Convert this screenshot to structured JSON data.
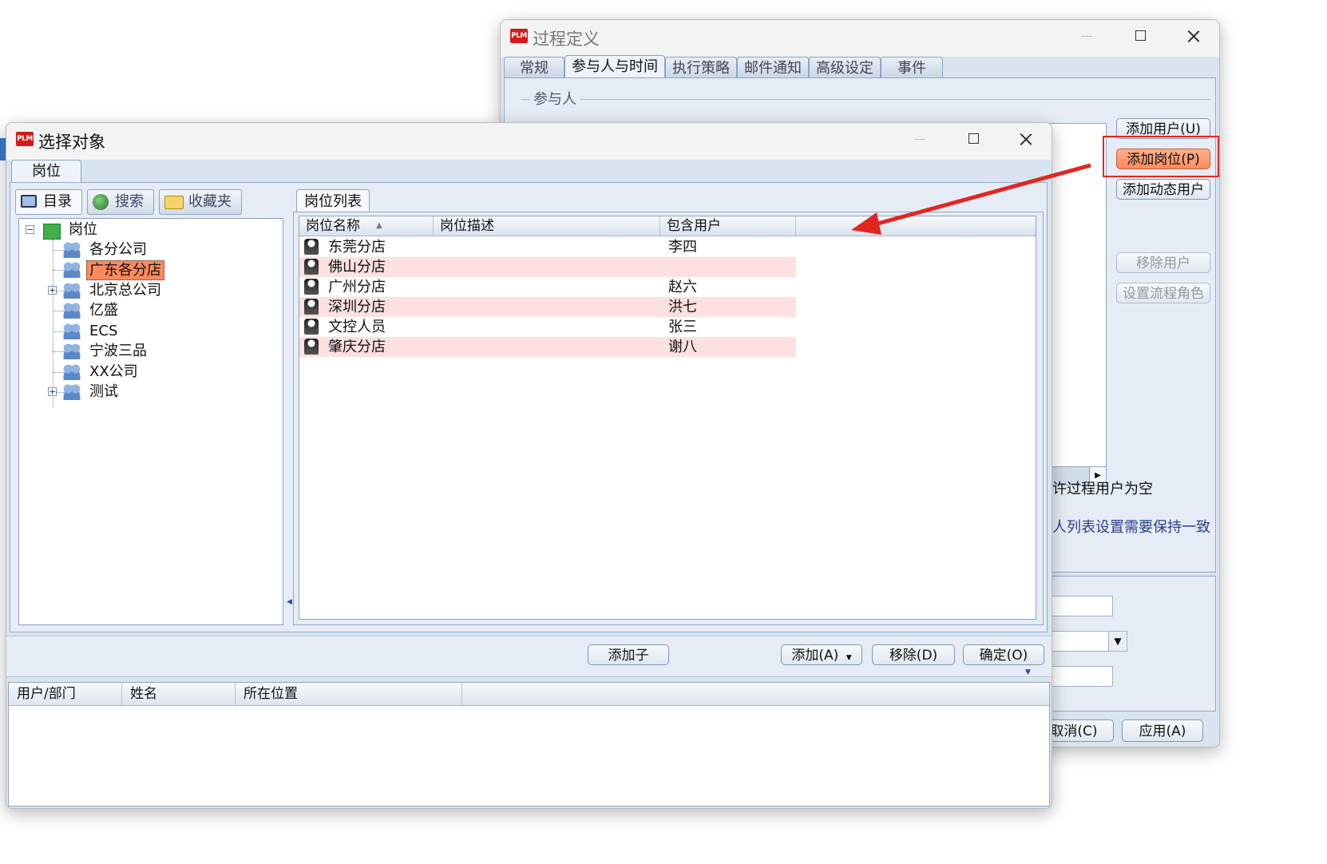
{
  "back_window": {
    "title": "过程定义",
    "tabs": [
      "常规",
      "参与人与时间",
      "执行策略",
      "邮件通知",
      "高级设定",
      "事件"
    ],
    "group_label": "参与人",
    "buttons": {
      "add_user": "添加用户(U)",
      "add_position": "添加岗位(P)",
      "add_dynamic_user": "添加动态用户",
      "remove_user": "移除用户",
      "set_process_role": "设置流程角色"
    },
    "checkbox_text_1": "许过程用户为空",
    "checkbox_text_2": "人列表设置需要保持一致",
    "footer": {
      "cancel": "取消(C)",
      "apply": "应用(A)"
    }
  },
  "front_window": {
    "title": "选择对象",
    "main_tab": "岗位",
    "left_tabs": [
      "目录",
      "搜索",
      "收藏夹"
    ],
    "tree": {
      "root": "岗位",
      "children": [
        {
          "label": "各分公司",
          "expandable": false
        },
        {
          "label": "广东各分店",
          "expandable": false,
          "selected": true
        },
        {
          "label": "北京总公司",
          "expandable": true
        },
        {
          "label": "亿盛",
          "expandable": false
        },
        {
          "label": "ECS",
          "expandable": false
        },
        {
          "label": "宁波三品",
          "expandable": false
        },
        {
          "label": "XX公司",
          "expandable": false
        },
        {
          "label": "测试",
          "expandable": true
        }
      ]
    },
    "list_tab": "岗位列表",
    "columns": [
      "岗位名称",
      "岗位描述",
      "包含用户"
    ],
    "rows": [
      {
        "name": "东莞分店",
        "desc": "",
        "users": "李四",
        "pink": false
      },
      {
        "name": "佛山分店",
        "desc": "",
        "users": "",
        "pink": true
      },
      {
        "name": "广州分店",
        "desc": "",
        "users": "赵六",
        "pink": false
      },
      {
        "name": "深圳分店",
        "desc": "",
        "users": "洪七",
        "pink": true
      },
      {
        "name": "文控人员",
        "desc": "",
        "users": "张三",
        "pink": false
      },
      {
        "name": "肇庆分店",
        "desc": "",
        "users": "谢八",
        "pink": true
      }
    ],
    "buttons": {
      "add_child": "添加子",
      "add": "添加(A)",
      "remove": "移除(D)",
      "ok": "确定(O)"
    },
    "bottom_columns": [
      "用户/部门",
      "姓名",
      "所在位置"
    ]
  },
  "colors": {
    "highlight_button": "#ff8a5c",
    "annotation_red": "#e2261f",
    "pink_row": "#fde0e0",
    "selection": "#ff8a5c"
  }
}
